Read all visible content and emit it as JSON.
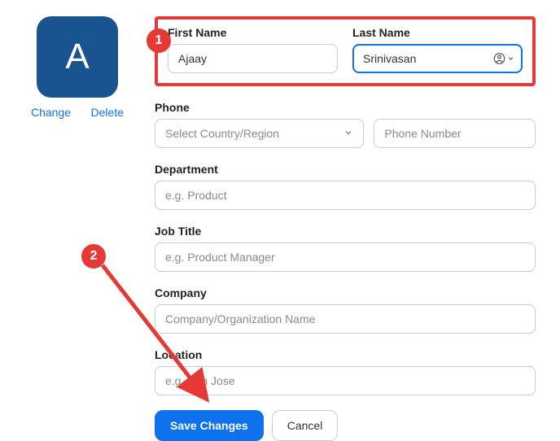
{
  "avatar": {
    "initial": "A",
    "change": "Change",
    "delete": "Delete"
  },
  "name": {
    "first_label": "First Name",
    "first_value": "Ajaay",
    "last_label": "Last Name",
    "last_value": "Srinivasan"
  },
  "phone": {
    "label": "Phone",
    "select_placeholder": "Select Country/Region",
    "number_placeholder": "Phone Number"
  },
  "department": {
    "label": "Department",
    "placeholder": "e.g. Product"
  },
  "job_title": {
    "label": "Job Title",
    "placeholder": "e.g. Product Manager"
  },
  "company": {
    "label": "Company",
    "placeholder": "Company/Organization Name"
  },
  "location": {
    "label": "Location",
    "placeholder": "e.g. San Jose"
  },
  "buttons": {
    "save": "Save Changes",
    "cancel": "Cancel"
  },
  "annotations": {
    "step1": "1",
    "step2": "2"
  }
}
